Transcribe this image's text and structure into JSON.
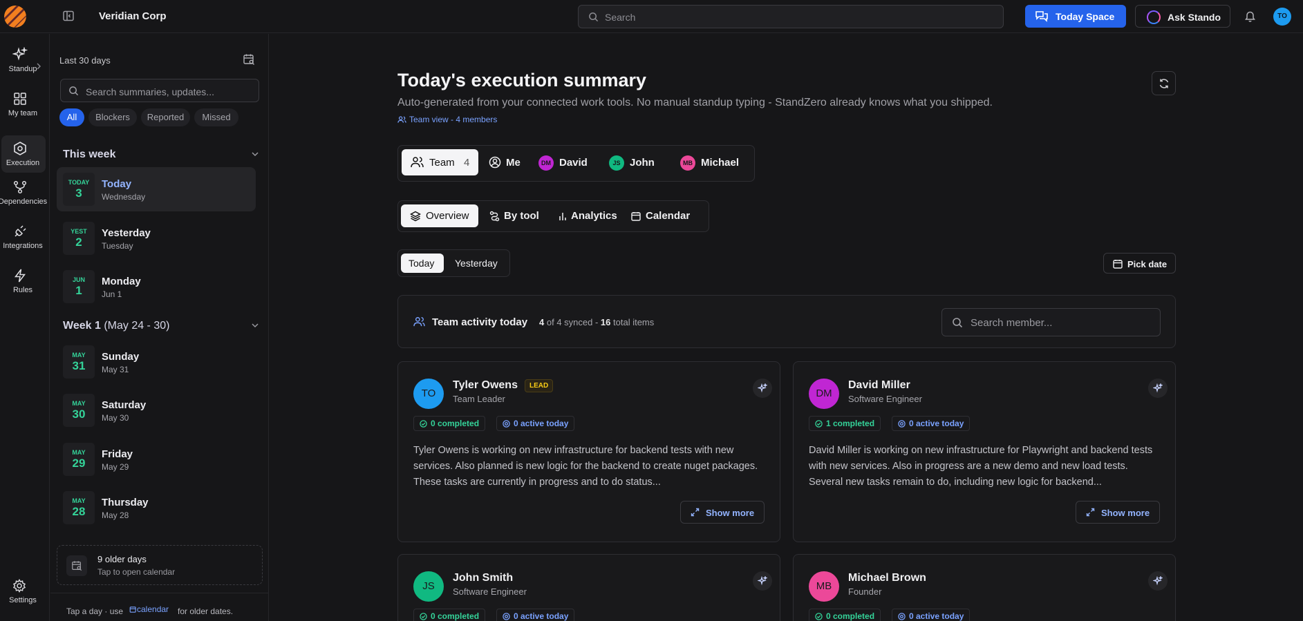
{
  "header": {
    "org_name": "Veridian Corp",
    "search_placeholder": "Search",
    "today_space_label": "Today Space",
    "ask_label": "Ask Stando",
    "user_initials": "TO"
  },
  "rail": {
    "items": [
      {
        "label": "Standup",
        "icon": "sparkles-icon"
      },
      {
        "label": "My team",
        "icon": "grid-icon"
      },
      {
        "label": "Execution",
        "icon": "hexagon-icon"
      },
      {
        "label": "Dependencies",
        "icon": "git-branch-icon"
      },
      {
        "label": "Integrations",
        "icon": "plug-icon"
      },
      {
        "label": "Rules",
        "icon": "bolt-icon"
      }
    ],
    "settings_label": "Settings"
  },
  "day_panel": {
    "range_label": "Last 30 days",
    "search_placeholder": "Search summaries, updates...",
    "filters": [
      "All",
      "Blockers",
      "Reported",
      "Missed"
    ],
    "active_filter": "All",
    "groups": [
      {
        "title": "This week",
        "days": [
          {
            "badge_month": "TODAY",
            "badge_day": "3",
            "name": "Today",
            "sub": "Wednesday",
            "active": true
          },
          {
            "badge_month": "YEST",
            "badge_day": "2",
            "name": "Yesterday",
            "sub": "Tuesday"
          },
          {
            "badge_month": "JUN",
            "badge_day": "1",
            "name": "Monday",
            "sub": "Jun 1"
          }
        ]
      },
      {
        "title": "Week 1",
        "subtitle": "(May 24 - 30)",
        "days": [
          {
            "badge_month": "MAY",
            "badge_day": "31",
            "name": "Sunday",
            "sub": "May 31"
          },
          {
            "badge_month": "MAY",
            "badge_day": "30",
            "name": "Saturday",
            "sub": "May 30"
          },
          {
            "badge_month": "MAY",
            "badge_day": "29",
            "name": "Friday",
            "sub": "May 29"
          },
          {
            "badge_month": "MAY",
            "badge_day": "28",
            "name": "Thursday",
            "sub": "May 28"
          }
        ]
      }
    ],
    "older": {
      "title": "9 older days",
      "subtitle": "Tap to open calendar"
    },
    "footer": {
      "prefix": "Tap a day · use",
      "link": "calendar",
      "suffix": "for older dates."
    }
  },
  "main": {
    "title": "Today's execution summary",
    "subtitle": "Auto-generated from your connected work tools. No manual standup typing - StandZero already knows what you shipped.",
    "team_view": "Team view - 4 members",
    "people_tabs": {
      "team_label": "Team",
      "team_count": "4",
      "me_label": "Me",
      "members": [
        {
          "initials": "DM",
          "name": "David",
          "color": "#c026d3"
        },
        {
          "initials": "JS",
          "name": "John",
          "color": "#10b981"
        },
        {
          "initials": "MB",
          "name": "Michael",
          "color": "#ec4899"
        }
      ]
    },
    "view_tabs": [
      "Overview",
      "By tool",
      "Analytics",
      "Calendar"
    ],
    "day_tabs": [
      "Today",
      "Yesterday"
    ],
    "pick_date": "Pick date",
    "activity": {
      "title": "Team activity today",
      "synced": "4",
      "synced_mid": "of 4 synced -",
      "total": "16",
      "total_suffix": "total items",
      "search_placeholder": "Search member..."
    },
    "members": [
      {
        "initials": "TO",
        "name": "Tyler Owens",
        "badge": "LEAD",
        "role": "Team Leader",
        "color": "#1d9bf0",
        "completed": "0 completed",
        "active": "0 active today",
        "summary": "Tyler Owens is working on new infrastructure for backend tests with new services. Also planned is new logic for the backend to create nuget packages. These tasks are currently in progress and to do status...",
        "show_more": "Show more"
      },
      {
        "initials": "DM",
        "name": "David Miller",
        "role": "Software Engineer",
        "color": "#c026d3",
        "completed": "1 completed",
        "active": "0 active today",
        "summary": "David Miller is working on new infrastructure for Playwright and backend tests with new services. Also in progress are a new demo and new load tests. Several new tasks remain to do, including new logic for backend...",
        "show_more": "Show more"
      },
      {
        "initials": "JS",
        "name": "John Smith",
        "role": "Software Engineer",
        "color": "#10b981",
        "completed": "0 completed",
        "active": "0 active today"
      },
      {
        "initials": "MB",
        "name": "Michael Brown",
        "role": "Founder",
        "color": "#ec4899",
        "completed": "0 completed",
        "active": "0 active today"
      }
    ]
  }
}
